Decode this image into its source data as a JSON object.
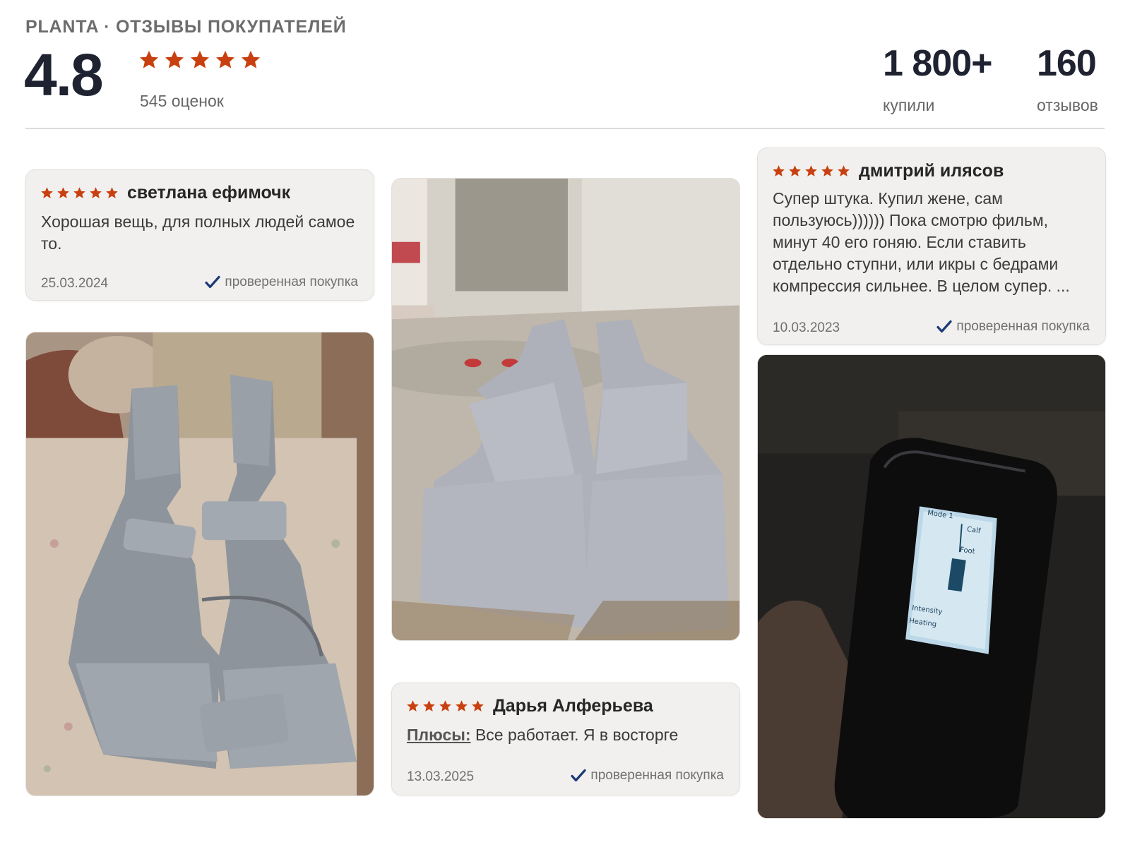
{
  "header": {
    "title": "PLANTA · ОТЗЫВЫ ПОКУПАТЕЛЕЙ",
    "rating": "4.8",
    "rating_count": "545 оценок",
    "bought_value": "1 800+",
    "bought_label": "купили",
    "reviews_value": "160",
    "reviews_label": "отзывов"
  },
  "reviews": [
    {
      "author": "светлана ефимочк",
      "text": "Хорошая вещь, для полных людей самое то.",
      "date": "25.03.2024",
      "verified": "проверенная покупка",
      "stars": 5
    },
    {
      "author": "Дарья Алферьева",
      "pros_label": "Плюсы:",
      "text": "Все работает. Я в восторге",
      "date": "13.03.2025",
      "verified": "проверенная покупка",
      "stars": 5
    },
    {
      "author": "дмитрий илясов",
      "text": "Супер штука. Купил жене, сам пользуюсь)))))) Пока смотрю фильм, минут 40 его гоняю. Если ставить отдельно ступни, или икры с бедрами компрессия сильнее. В целом супер. ...",
      "date": "10.03.2023",
      "verified": "проверенная покупка",
      "stars": 5
    }
  ],
  "device_screen": {
    "mode": "Mode 1",
    "calf": "Calf",
    "foot": "Foot",
    "intensity": "Intensity",
    "heating": "Heating"
  },
  "colors": {
    "star": "#c8400f",
    "check": "#1d3a78",
    "card_bg": "#f1f0ee"
  }
}
